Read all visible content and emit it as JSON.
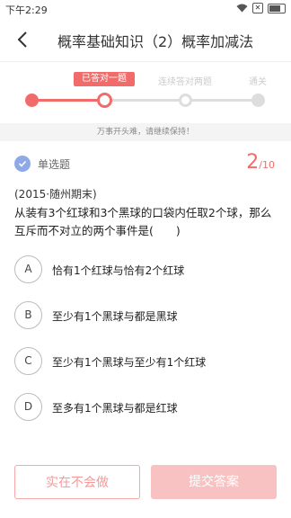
{
  "status_bar": {
    "time": "下午2:29",
    "battery_icon": "battery-icon",
    "wifi_icon": "wifi-icon"
  },
  "header": {
    "title": "概率基础知识（2）概率加减法",
    "back_icon": "chevron-left-icon"
  },
  "progress": {
    "current_badge": "已答对一题",
    "step2_label": "连续答对两题",
    "step3_label": "通关",
    "hint": "万事开头难，请继续保持！",
    "colors": {
      "active": "#f26b6b",
      "inactive": "#dddddd"
    }
  },
  "question": {
    "type_label": "单选题",
    "current": "2",
    "total": "/10",
    "source": "(2015·随州期末)",
    "text": "从装有3个红球和3个黑球的口袋内任取2个球，那么互斥而不对立的两个事件是(　　)",
    "options": [
      {
        "letter": "A",
        "text": "恰有1个红球与恰有2个红球"
      },
      {
        "letter": "B",
        "text": "至少有1个黑球与都是黑球"
      },
      {
        "letter": "C",
        "text": "至少有1个黑球与至少有1个红球"
      },
      {
        "letter": "D",
        "text": "至多有1个黑球与都是红球"
      }
    ]
  },
  "footer": {
    "give_up_label": "实在不会做",
    "submit_label": "提交答案"
  }
}
